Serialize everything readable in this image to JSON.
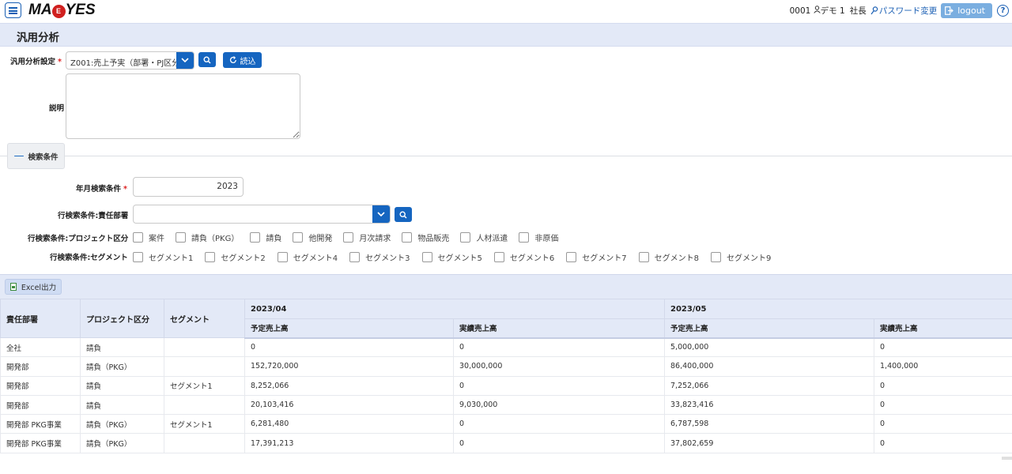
{
  "header": {
    "logo_left": "MA",
    "logo_mid": "E",
    "logo_right": "YES",
    "user_info": "0001 　\u0000",
    "user_code": "0001",
    "user_name": "デモ 1",
    "role": "社長",
    "password_link": "パスワード変更",
    "logout_label": "logout",
    "help_glyph": "?"
  },
  "page": {
    "title": "汎用分析"
  },
  "form": {
    "setting_label": "汎用分析設定",
    "required_mark": "*",
    "setting_value": "Z001:売上予実（部署・PJ区分",
    "load_label": "読込",
    "description_label": "説明",
    "search_toggle_label": "検索条件",
    "year_label": "年月検索条件",
    "year_value": "2023",
    "dept_label": "行検索条件:責任部署",
    "dept_value": "",
    "project_label": "行検索条件:プロジェクト区分",
    "project_options": [
      "案件",
      "請負（PKG）",
      "請負",
      "他開発",
      "月次請求",
      "物品販売",
      "人材派遣",
      "非原価"
    ],
    "segment_label": "行検索条件:セグメント",
    "segment_options": [
      "セグメント1",
      "セグメント2",
      "セグメント4",
      "セグメント3",
      "セグメント5",
      "セグメント6",
      "セグメント7",
      "セグメント8",
      "セグメント9"
    ]
  },
  "toolbar": {
    "excel_label": "Excel出力"
  },
  "table": {
    "headers": {
      "dept": "責任部署",
      "project": "プロジェクト区分",
      "segment": "セグメント",
      "period1": "2023/04",
      "period2": "2023/05",
      "planned": "予定売上高",
      "actual": "実績売上高"
    },
    "rows": [
      [
        "全社",
        "請負",
        "",
        "0",
        "0",
        "5,000,000",
        "0"
      ],
      [
        "開発部",
        "請負（PKG）",
        "",
        "152,720,000",
        "30,000,000",
        "86,400,000",
        "1,400,000"
      ],
      [
        "開発部",
        "請負",
        "セグメント1",
        "8,252,066",
        "0",
        "7,252,066",
        "0"
      ],
      [
        "開発部",
        "請負",
        "",
        "20,103,416",
        "9,030,000",
        "33,823,416",
        "0"
      ],
      [
        "開発部 PKG事業",
        "請負（PKG）",
        "セグメント1",
        "6,281,480",
        "0",
        "6,787,598",
        "0"
      ],
      [
        "開発部 PKG事業",
        "請負（PKG）",
        "",
        "17,391,213",
        "0",
        "37,802,659",
        "0"
      ]
    ]
  },
  "colors": {
    "accent": "#1565c0",
    "header_bg": "#e3e9f7",
    "required": "#dd2222"
  }
}
